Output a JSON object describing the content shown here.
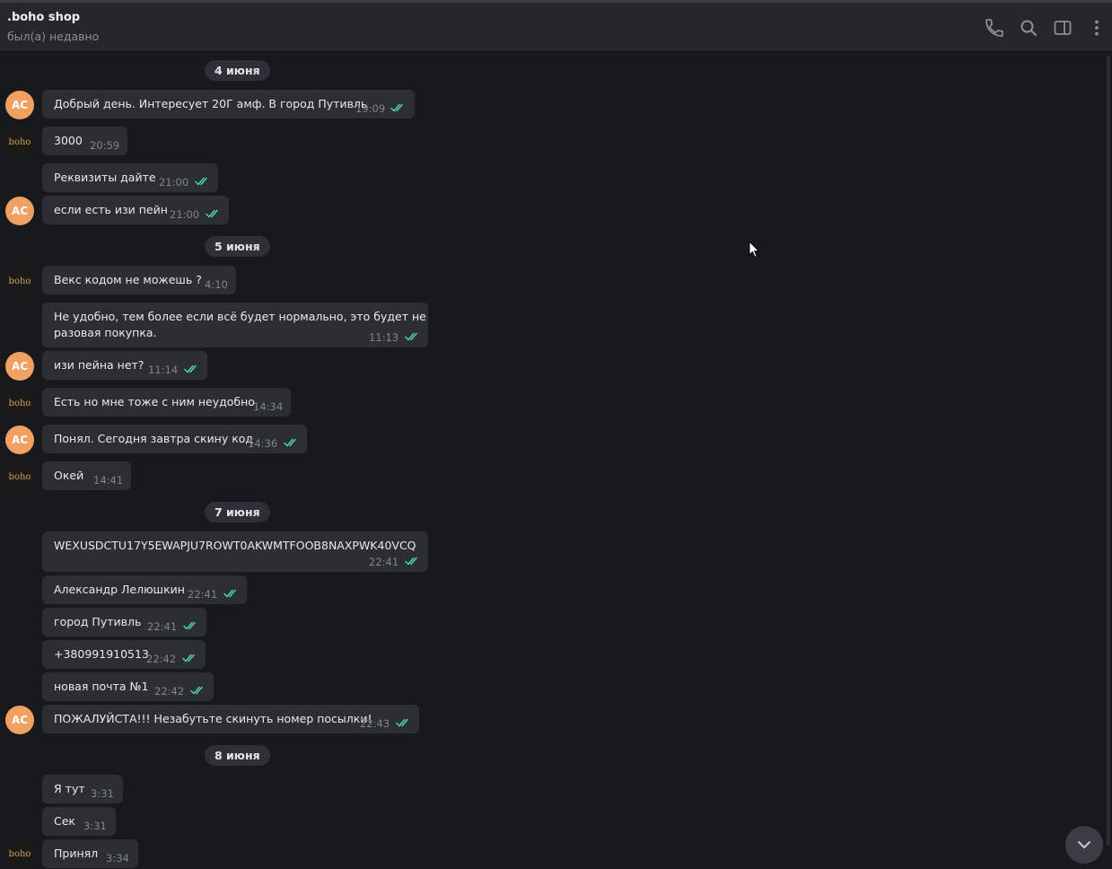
{
  "header": {
    "title": ".boho shop",
    "status": "был(а) недавно",
    "icons": [
      "phone-icon",
      "search-icon",
      "sidebar-toggle-icon",
      "more-vertical-icon"
    ]
  },
  "avatars": {
    "ac_initials": "AC",
    "boho_label": "boho"
  },
  "dates": [
    "4 июня",
    "5 июня",
    "7 июня",
    "8 июня"
  ],
  "messages": [
    {
      "text": "Добрый день. Интересует 20Г амф. В город Путивль",
      "time": "19:09"
    },
    {
      "text": "3000",
      "time": "20:59"
    },
    {
      "text": "Реквизиты дайте",
      "time": "21:00"
    },
    {
      "text": "если есть изи пейн",
      "time": "21:00"
    },
    {
      "text": "Векс кодом не можешь ?",
      "time": "4:10"
    },
    {
      "text": "Не удобно, тем более если всё будет нормально, это будет не",
      "text2": "разовая покупка.",
      "time": "11:13"
    },
    {
      "text": "изи пейна нет?",
      "time": "11:14"
    },
    {
      "text": "Есть но мне тоже с ним неудобно",
      "time": "14:34"
    },
    {
      "text": "Понял. Сегодня завтра скину код",
      "time": "14:36"
    },
    {
      "text": "Окей",
      "time": "14:41"
    },
    {
      "text": "WEXUSDCTU17Y5EWAPJU7ROWT0AKWMTFOOB8NAXPWK40VCQ",
      "time": "22:41"
    },
    {
      "text": "Александр Лелюшкин",
      "time": "22:41"
    },
    {
      "text": "город Путивль",
      "time": "22:41"
    },
    {
      "text": "+380991910513",
      "time": "22:42"
    },
    {
      "text": "новая почта №1",
      "time": "22:42"
    },
    {
      "text": "ПОЖАЛУЙСТА!!! Незабутьте скинуть номер посылки!",
      "time": "22:43"
    },
    {
      "text": "Я тут",
      "time": "3:31"
    },
    {
      "text": "Сек",
      "time": "3:31"
    },
    {
      "text": "Принял",
      "time": "3:34"
    }
  ],
  "colors": {
    "background": "#17191d",
    "bubble": "#2b2f34",
    "read_check": "#4fd1b4",
    "avatar_ac": "#f0a060"
  }
}
